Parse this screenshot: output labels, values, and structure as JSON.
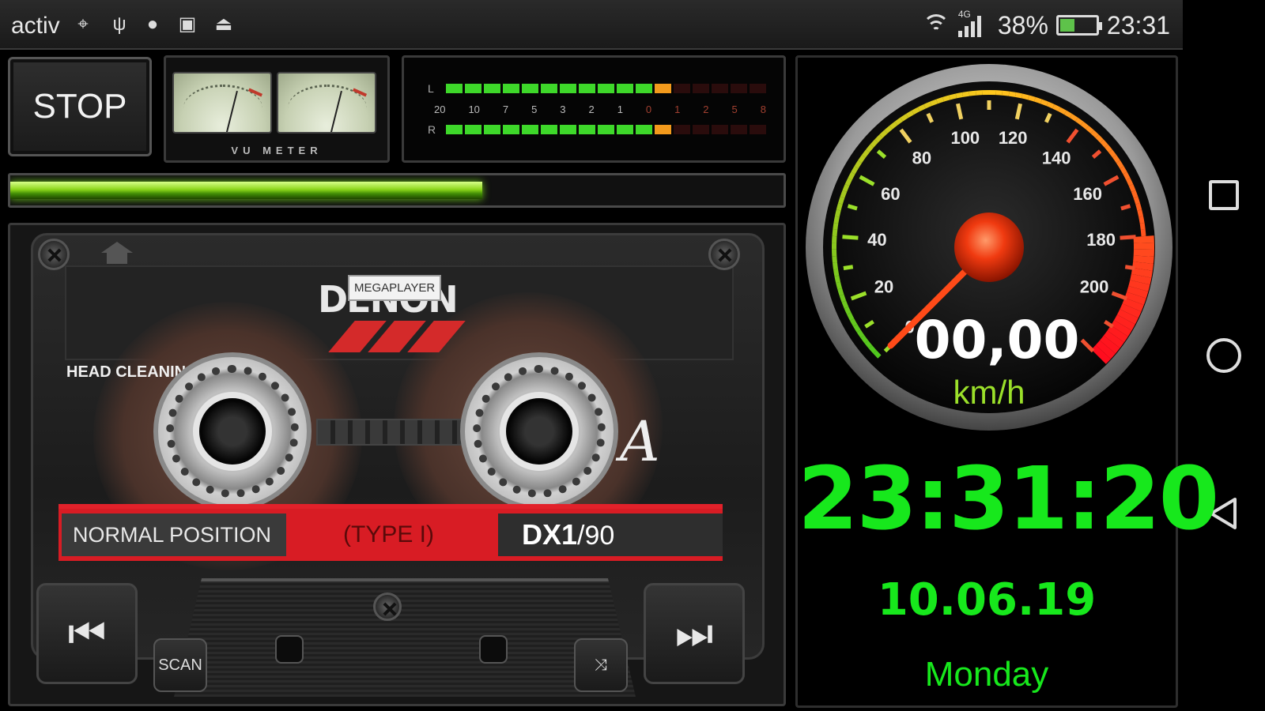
{
  "status_bar": {
    "carrier": "activ",
    "network_type": "4G",
    "battery": "38%",
    "time": "23:31",
    "icons": [
      "location-icon",
      "usb-icon",
      "android-debug-icon",
      "image-icon",
      "printer-icon"
    ]
  },
  "player": {
    "stop_label": "STOP",
    "vu_label": "VU METER",
    "level_scale": [
      "20",
      "10",
      "7",
      "5",
      "3",
      "2",
      "1",
      "0",
      "1",
      "2",
      "5",
      "8"
    ],
    "channel_left": "L",
    "channel_right": "R",
    "level_left_green": 11,
    "level_left_orange": 1,
    "level_right_green": 11,
    "level_right_orange": 1,
    "progress_fraction": 0.61
  },
  "cassette": {
    "brand": "DENON",
    "brand_tag": "MEGAPLAYER",
    "head_leader": "HEAD CLEANING LEADER",
    "side": "A",
    "position": "NORMAL POSITION",
    "type": "(TYPE I)",
    "model": "DX1",
    "length": "/90",
    "scan_label": "SCAN"
  },
  "speedometer": {
    "ticks": [
      "0",
      "20",
      "40",
      "60",
      "80",
      "100",
      "120",
      "140",
      "160",
      "180",
      "200"
    ],
    "speed": "00,00",
    "unit": "km/h",
    "value": 0,
    "max": 220
  },
  "clock": {
    "time": "23:31:20",
    "date": "10.06.19",
    "weekday": "Monday"
  },
  "colors": {
    "clock_green": "#17e81c",
    "cassette_red": "#d81c24",
    "progress_green": "#8bd51a"
  }
}
